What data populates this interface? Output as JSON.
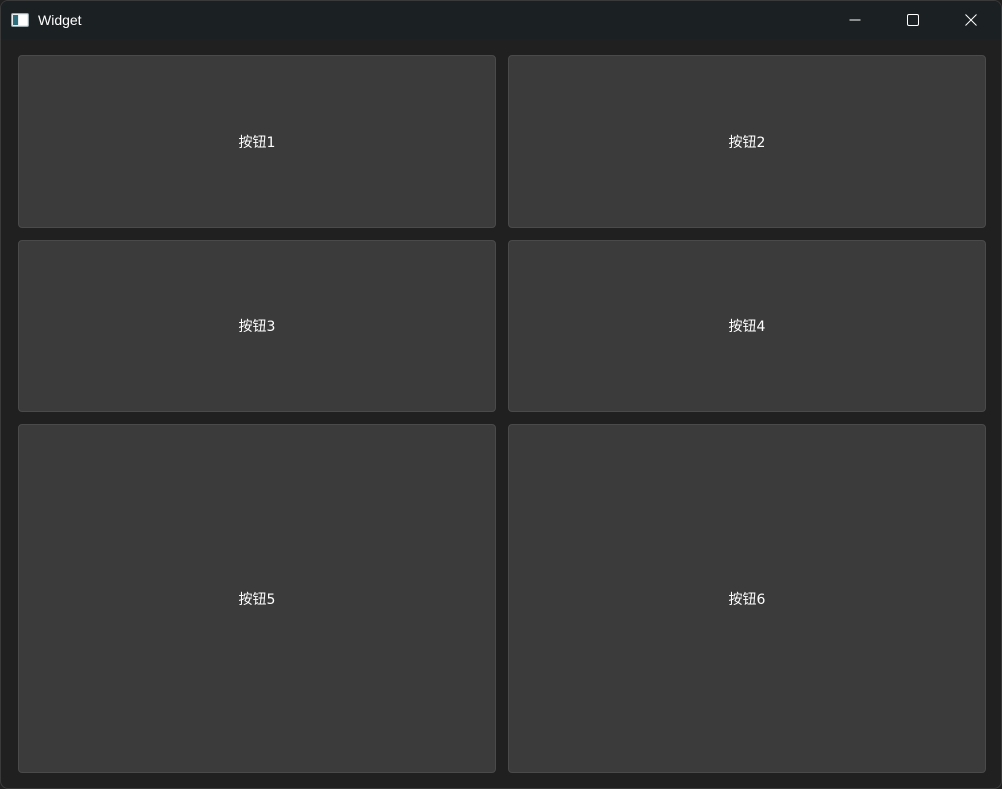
{
  "window": {
    "title": "Widget",
    "icons": {
      "app": "app-window-icon",
      "minimize": "minimize-icon",
      "maximize": "maximize-icon",
      "close": "close-icon"
    }
  },
  "buttons": [
    {
      "label": "按钮1"
    },
    {
      "label": "按钮2"
    },
    {
      "label": "按钮3"
    },
    {
      "label": "按钮4"
    },
    {
      "label": "按钮5"
    },
    {
      "label": "按钮6"
    }
  ],
  "colors": {
    "titlebar_bg": "#1b2022",
    "window_bg": "#202020",
    "button_bg": "#3b3b3b",
    "button_border": "#4a4a4a",
    "text": "#ffffff"
  }
}
